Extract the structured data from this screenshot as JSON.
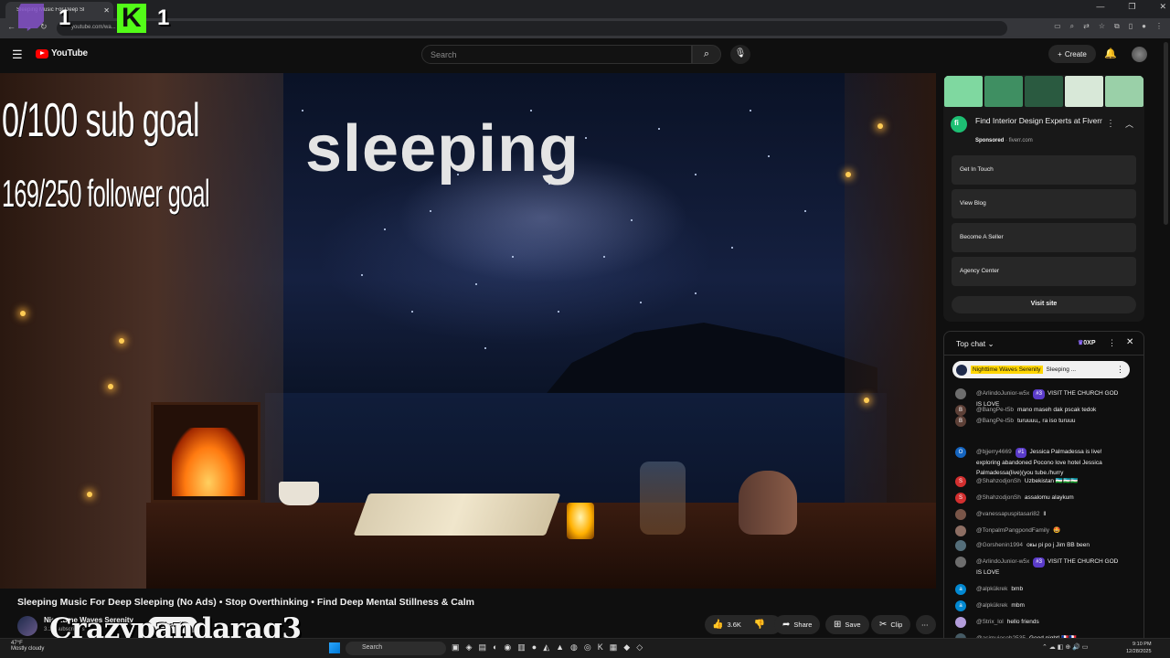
{
  "browser": {
    "tab_title": "Sleeping Music For Deep Sle...",
    "url": "youtube.com/wa...",
    "window_controls": [
      "—",
      "❐",
      "✕"
    ]
  },
  "header": {
    "logo_text": "YouTube",
    "search_placeholder": "Search",
    "create_label": "Create"
  },
  "overlay": {
    "counter_twitch": "1",
    "counter_kick": "1",
    "sub_goal": "0/100 sub goal",
    "follower_goal": "169/250 follower goal",
    "video_text": "sleeping",
    "watermark": "Crazypandarag3"
  },
  "video": {
    "title": "Sleeping Music For Deep Sleeping (No Ads) • Stop Overthinking • Find Deep Mental Stillness & Calm",
    "channel_name": "Nighttime Waves Serenity",
    "channel_subs": "3.1K subscribers",
    "subscribe_label": "Subscribe",
    "like_count": "3.6K",
    "share_label": "Share",
    "save_label": "Save",
    "clip_label": "Clip"
  },
  "ad": {
    "title": "Find Interior Design Experts at Fiverr",
    "sponsored": "Sponsored",
    "domain": "fiverr.com",
    "links": [
      "Get In Touch",
      "View Blog",
      "Become A Seller",
      "Agency Center"
    ],
    "visit_label": "Visit site",
    "banner_colors": [
      "#7fd8a0",
      "#3f8f62",
      "#2a5a40",
      "#d8e8d8",
      "#9ad0a8"
    ]
  },
  "chat": {
    "title": "Top chat",
    "xp": "0XP",
    "pinned": {
      "name": "Nighttime Waves Serenity",
      "text": "Sleeping ..."
    },
    "messages": [
      {
        "author": "@ArlindoJunior-w5x",
        "badge": "#3",
        "text": "VISIT THE CHURCH GOD IS LOVE",
        "initial": "",
        "color": "#6d6d6d"
      },
      {
        "author": "@BangPe-t5b",
        "badge": "",
        "text": "mano maseh dak pscak tedok",
        "initial": "B",
        "color": "#5d4037"
      },
      {
        "author": "@BangPe-t5b",
        "badge": "",
        "text": "turuuuu,, ra iso turuuu",
        "initial": "B",
        "color": "#5d4037"
      },
      {
        "author": "@bjjerry4669",
        "badge": "#1",
        "text": "Jessica Palmadessa is live! exploring abandoned Pocono love hotel Jessica Palmadessa(live)(you tube./hurry",
        "initial": "O",
        "color": "#1565c0"
      },
      {
        "author": "@ShahzodjonSh",
        "badge": "",
        "text": "Uzbekistan 🇺🇿🇺🇿🇺🇿",
        "initial": "S",
        "color": "#d32f2f"
      },
      {
        "author": "@ShahzodjonSh",
        "badge": "",
        "text": "assalomu alaykum",
        "initial": "S",
        "color": "#d32f2f"
      },
      {
        "author": "@vanessapuspitasari82",
        "badge": "",
        "text": "ll",
        "initial": "",
        "color": "#795548"
      },
      {
        "author": "@TonpalmPangpondFamily",
        "badge": "",
        "text": "🤩",
        "initial": "",
        "color": "#8d6e63"
      },
      {
        "author": "@Gorshenin1994",
        "badge": "",
        "text": "окы рі ро j Jim BB been",
        "initial": "",
        "color": "#546e7a"
      },
      {
        "author": "@ArlindoJunior-w5x",
        "badge": "#3",
        "text": "VISIT THE CHURCH GOD IS LOVE",
        "initial": "",
        "color": "#6d6d6d"
      },
      {
        "author": "@alpkükrek",
        "badge": "",
        "text": "bmb",
        "initial": "a",
        "color": "#0288d1"
      },
      {
        "author": "@alpkükrek",
        "badge": "",
        "text": "mbm",
        "initial": "a",
        "color": "#0288d1"
      },
      {
        "author": "@Strix_lol",
        "badge": "",
        "text": "hello friends",
        "initial": "",
        "color": "#b39ddb"
      },
      {
        "author": "@asimuiosob2535",
        "badge": "",
        "text": "Good night! 🇫🇷🇫🇷",
        "initial": "",
        "color": "#455a64"
      }
    ]
  },
  "taskbar": {
    "temp": "47°F",
    "weather": "Mostly cloudy",
    "search": "Search",
    "time": "9:10 PM",
    "date": "12/28/2025"
  }
}
